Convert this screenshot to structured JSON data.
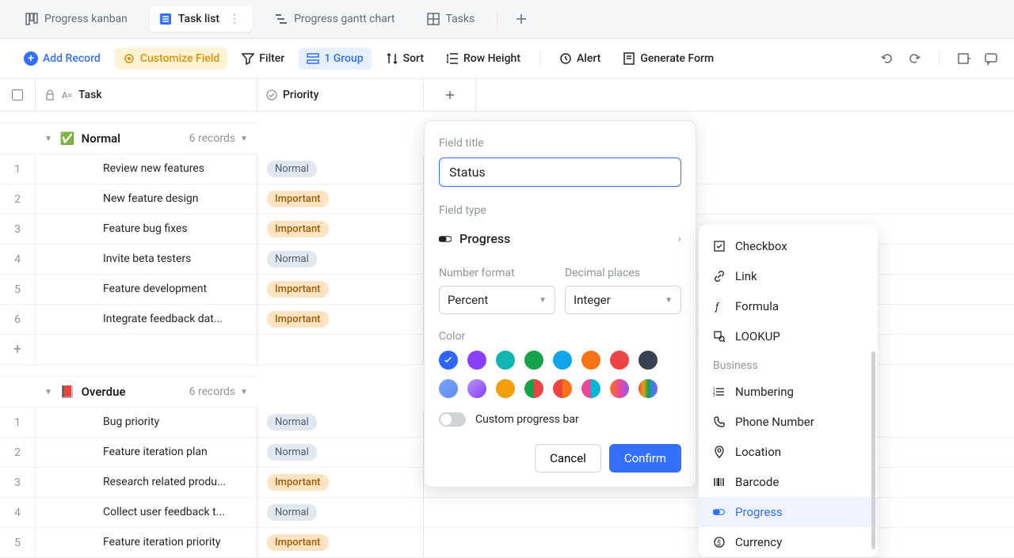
{
  "tabs": {
    "progress_kanban": "Progress kanban",
    "task_list": "Task list",
    "progress_gantt": "Progress gantt chart",
    "tasks": "Tasks"
  },
  "toolbar": {
    "add_record": "Add Record",
    "customize_field": "Customize Field",
    "filter": "Filter",
    "group": "1 Group",
    "sort": "Sort",
    "row_height": "Row Height",
    "alert": "Alert",
    "generate_form": "Generate Form"
  },
  "columns": {
    "task": "Task",
    "priority": "Priority"
  },
  "groups": [
    {
      "name": "Normal",
      "emoji": "✅",
      "count_label": "6 records",
      "rows": [
        {
          "idx": "1",
          "task": "Review new features",
          "priority": "Normal"
        },
        {
          "idx": "2",
          "task": "New feature design",
          "priority": "Important"
        },
        {
          "idx": "3",
          "task": "Feature bug fixes",
          "priority": "Important"
        },
        {
          "idx": "4",
          "task": "Invite beta testers",
          "priority": "Normal"
        },
        {
          "idx": "5",
          "task": "Feature development",
          "priority": "Important"
        },
        {
          "idx": "6",
          "task": "Integrate feedback dat...",
          "priority": "Important"
        }
      ]
    },
    {
      "name": "Overdue",
      "emoji": "📕",
      "count_label": "6 records",
      "rows": [
        {
          "idx": "1",
          "task": "Bug priority",
          "priority": "Normal"
        },
        {
          "idx": "2",
          "task": "Feature iteration plan",
          "priority": "Normal"
        },
        {
          "idx": "3",
          "task": "Research related produ...",
          "priority": "Important"
        },
        {
          "idx": "4",
          "task": "Collect user feedback t...",
          "priority": "Normal"
        },
        {
          "idx": "5",
          "task": "Feature iteration priority",
          "priority": "Important"
        }
      ]
    }
  ],
  "popover": {
    "field_title_label": "Field title",
    "field_title_value": "Status",
    "field_type_label": "Field type",
    "field_type_value": "Progress",
    "number_format_label": "Number format",
    "number_format_value": "Percent",
    "decimal_label": "Decimal places",
    "decimal_value": "Integer",
    "color_label": "Color",
    "colors": [
      "#2c66ff",
      "#8a3ffc",
      "#0fb5ae",
      "#16a34a",
      "#0ea5e9",
      "#f97316",
      "#ef4444",
      "#374151",
      "#7ca3ff",
      "#b794f6",
      "#f59e0b",
      "#g1",
      "#g2",
      "#g3",
      "#g4",
      "#g5"
    ],
    "custom_progress_label": "Custom progress bar",
    "cancel": "Cancel",
    "confirm": "Confirm"
  },
  "type_menu": {
    "checkbox": "Checkbox",
    "link": "Link",
    "formula": "Formula",
    "lookup": "LOOKUP",
    "section_business": "Business",
    "numbering": "Numbering",
    "phone": "Phone Number",
    "location": "Location",
    "barcode": "Barcode",
    "progress": "Progress",
    "currency": "Currency"
  }
}
